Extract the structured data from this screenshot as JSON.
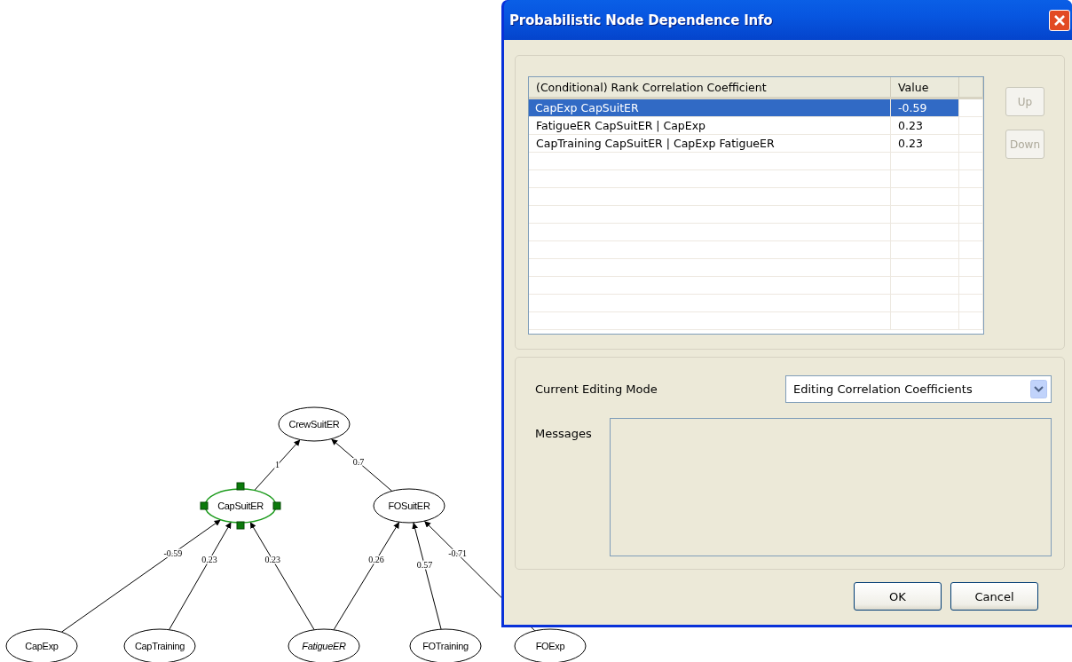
{
  "diagram": {
    "nodes": [
      {
        "label": "CrewSuitER",
        "selected": false,
        "emphasized": false
      },
      {
        "label": "CapSuitER",
        "selected": true,
        "emphasized": false
      },
      {
        "label": "FOSuitER",
        "selected": false,
        "emphasized": false
      },
      {
        "label": "CapExp",
        "selected": false,
        "emphasized": false
      },
      {
        "label": "CapTraining",
        "selected": false,
        "emphasized": false
      },
      {
        "label": "FatigueER",
        "selected": false,
        "emphasized": true
      },
      {
        "label": "FOTraining",
        "selected": false,
        "emphasized": false
      },
      {
        "label": "FOExp",
        "selected": false,
        "emphasized": false
      }
    ],
    "edges": [
      {
        "label": "1"
      },
      {
        "label": "0.7"
      },
      {
        "label": "-0.59"
      },
      {
        "label": "0.23"
      },
      {
        "label": "0.23"
      },
      {
        "label": "0.26"
      },
      {
        "label": "0.57"
      },
      {
        "label": "-0.71"
      }
    ]
  },
  "dialog": {
    "title": "Probabilistic Node Dependence Info",
    "table": {
      "columns": [
        "(Conditional) Rank Correlation Coefficient",
        "Value"
      ],
      "rows": [
        {
          "cells": [
            "CapExp CapSuitER",
            "-0.59"
          ],
          "selected": true
        },
        {
          "cells": [
            "FatigueER CapSuitER | CapExp",
            "0.23"
          ],
          "selected": false
        },
        {
          "cells": [
            "CapTraining CapSuitER | CapExp FatigueER",
            "0.23"
          ],
          "selected": false
        }
      ]
    },
    "side_buttons": [
      {
        "label": "Up",
        "disabled": true
      },
      {
        "label": "Down",
        "disabled": true
      }
    ],
    "editing_mode": {
      "label": "Current Editing Mode",
      "value": "Editing Correlation Coefficients"
    },
    "messages": {
      "label": "Messages"
    },
    "buttons": [
      "OK",
      "Cancel"
    ]
  }
}
